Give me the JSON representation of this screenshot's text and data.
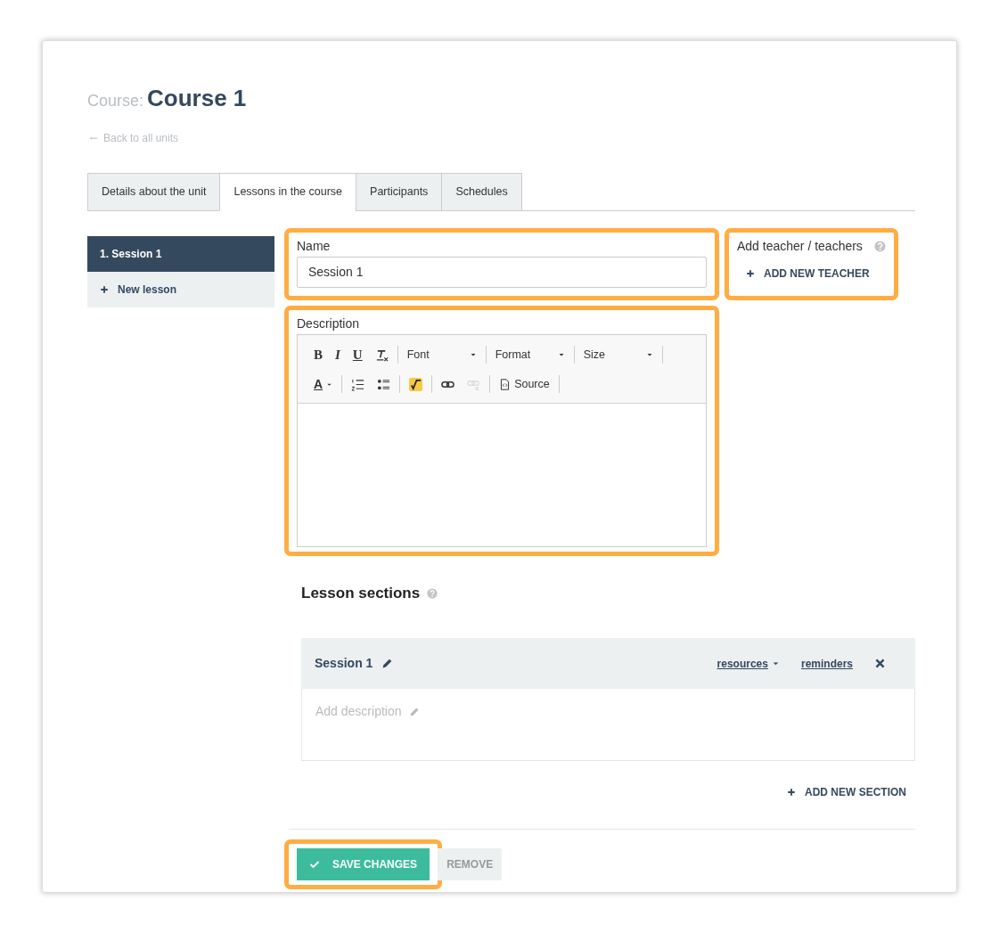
{
  "header": {
    "label": "Course:",
    "title": "Course 1",
    "back_link": "Back to all units"
  },
  "tabs": [
    {
      "label": "Details about the unit",
      "selected": false
    },
    {
      "label": "Lessons in the course",
      "selected": true
    },
    {
      "label": "Participants",
      "selected": false
    },
    {
      "label": "Schedules",
      "selected": false
    }
  ],
  "lessons": [
    {
      "label": "1. Session 1",
      "selected": true
    }
  ],
  "new_lesson": "New lesson",
  "name_field": {
    "label": "Name",
    "value": "Session 1",
    "highlighted": true
  },
  "teachers": {
    "label": "Add teacher / teachers",
    "action": "ADD NEW TEACHER",
    "highlighted": true
  },
  "description": {
    "label": "Description",
    "highlighted": true,
    "toolbar": [
      [
        [
          {
            "kind": "bold",
            "label": "B",
            "disabled": false
          },
          {
            "kind": "italic",
            "label": "I",
            "disabled": false
          },
          {
            "kind": "underline",
            "label": "U",
            "disabled": false
          },
          {
            "kind": "clear_format",
            "disabled": false
          }
        ],
        [
          {
            "kind": "dropdown",
            "label": "Font",
            "disabled": false
          }
        ],
        [
          {
            "kind": "dropdown",
            "label": "Format",
            "disabled": false
          }
        ],
        [
          {
            "kind": "dropdown",
            "label": "Size",
            "disabled": false
          }
        ]
      ],
      [
        [
          {
            "kind": "text_color",
            "label": "A",
            "disabled": false
          }
        ],
        [
          {
            "kind": "numbered_list",
            "disabled": false
          },
          {
            "kind": "bullet_list",
            "disabled": false
          }
        ],
        [
          {
            "kind": "formula",
            "disabled": false
          }
        ],
        [
          {
            "kind": "link",
            "disabled": false
          },
          {
            "kind": "unlink",
            "disabled": true
          }
        ],
        [
          {
            "kind": "source",
            "label": "Source",
            "disabled": false
          }
        ]
      ]
    ]
  },
  "sections_heading": "Lesson sections",
  "sections": [
    {
      "title": "Session 1",
      "links": [
        "resources",
        "reminders"
      ],
      "description_placeholder": "Add description"
    }
  ],
  "add_section": "ADD NEW SECTION",
  "buttons": [
    {
      "label": "SAVE CHANGES",
      "kind": "primary",
      "highlighted": true
    },
    {
      "label": "REMOVE",
      "kind": "secondary",
      "highlighted": false
    }
  ]
}
